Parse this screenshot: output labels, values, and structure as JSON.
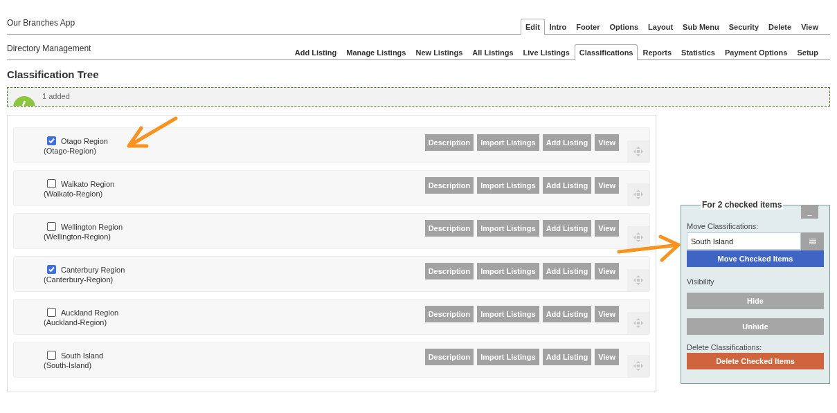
{
  "app_title": "Our Branches App",
  "app_tabs": [
    {
      "label": "Edit",
      "selected": true
    },
    {
      "label": "Intro",
      "selected": false
    },
    {
      "label": "Footer",
      "selected": false
    },
    {
      "label": "Options",
      "selected": false
    },
    {
      "label": "Layout",
      "selected": false
    },
    {
      "label": "Sub Menu",
      "selected": false
    },
    {
      "label": "Security",
      "selected": false
    },
    {
      "label": "Delete",
      "selected": false
    },
    {
      "label": "View",
      "selected": false
    }
  ],
  "section_title": "Directory Management",
  "section_tabs": [
    {
      "label": "Add Listing",
      "selected": false
    },
    {
      "label": "Manage Listings",
      "selected": false
    },
    {
      "label": "New Listings",
      "selected": false
    },
    {
      "label": "All Listings",
      "selected": false
    },
    {
      "label": "Live Listings",
      "selected": false
    },
    {
      "label": "Classifications",
      "selected": true
    },
    {
      "label": "Reports",
      "selected": false
    },
    {
      "label": "Statistics",
      "selected": false
    },
    {
      "label": "Payment Options",
      "selected": false
    },
    {
      "label": "Setup",
      "selected": false
    }
  ],
  "page_title": "Classification Tree",
  "message": "1 added",
  "classifications": [
    {
      "name": "Otago Region",
      "slug": "(Otago-Region)",
      "checked": true,
      "buttons": [
        "Description",
        "Import Listings",
        "Add Listing",
        "View"
      ]
    },
    {
      "name": "Waikato Region",
      "slug": "(Waikato-Region)",
      "checked": false,
      "buttons": [
        "Description",
        "Import Listings",
        "Add Listing",
        "View"
      ]
    },
    {
      "name": "Wellington Region",
      "slug": "(Wellington-Region)",
      "checked": false,
      "buttons": [
        "Description",
        "Import Listings",
        "Add Listing",
        "View"
      ]
    },
    {
      "name": "Canterbury Region",
      "slug": "(Canterbury-Region)",
      "checked": true,
      "buttons": [
        "Description",
        "Import Listings",
        "Add Listing",
        "View"
      ]
    },
    {
      "name": "Auckland Region",
      "slug": "(Auckland-Region)",
      "checked": false,
      "buttons": [
        "Description",
        "Import Listings",
        "Add Listing",
        "View"
      ]
    },
    {
      "name": "South Island",
      "slug": "(South-Island)",
      "checked": false,
      "buttons": [
        "Description",
        "Import Listings",
        "Add Listing",
        "View"
      ]
    }
  ],
  "panel": {
    "legend": "For 2 checked items",
    "collapse": "_",
    "move_label": "Move Classifications:",
    "move_value": "South Island",
    "move_button": "Move Checked Items",
    "visibility_label": "Visibility",
    "hide_button": "Hide",
    "unhide_button": "Unhide",
    "delete_label": "Delete Classifications:",
    "delete_button": "Delete Checked Items"
  }
}
